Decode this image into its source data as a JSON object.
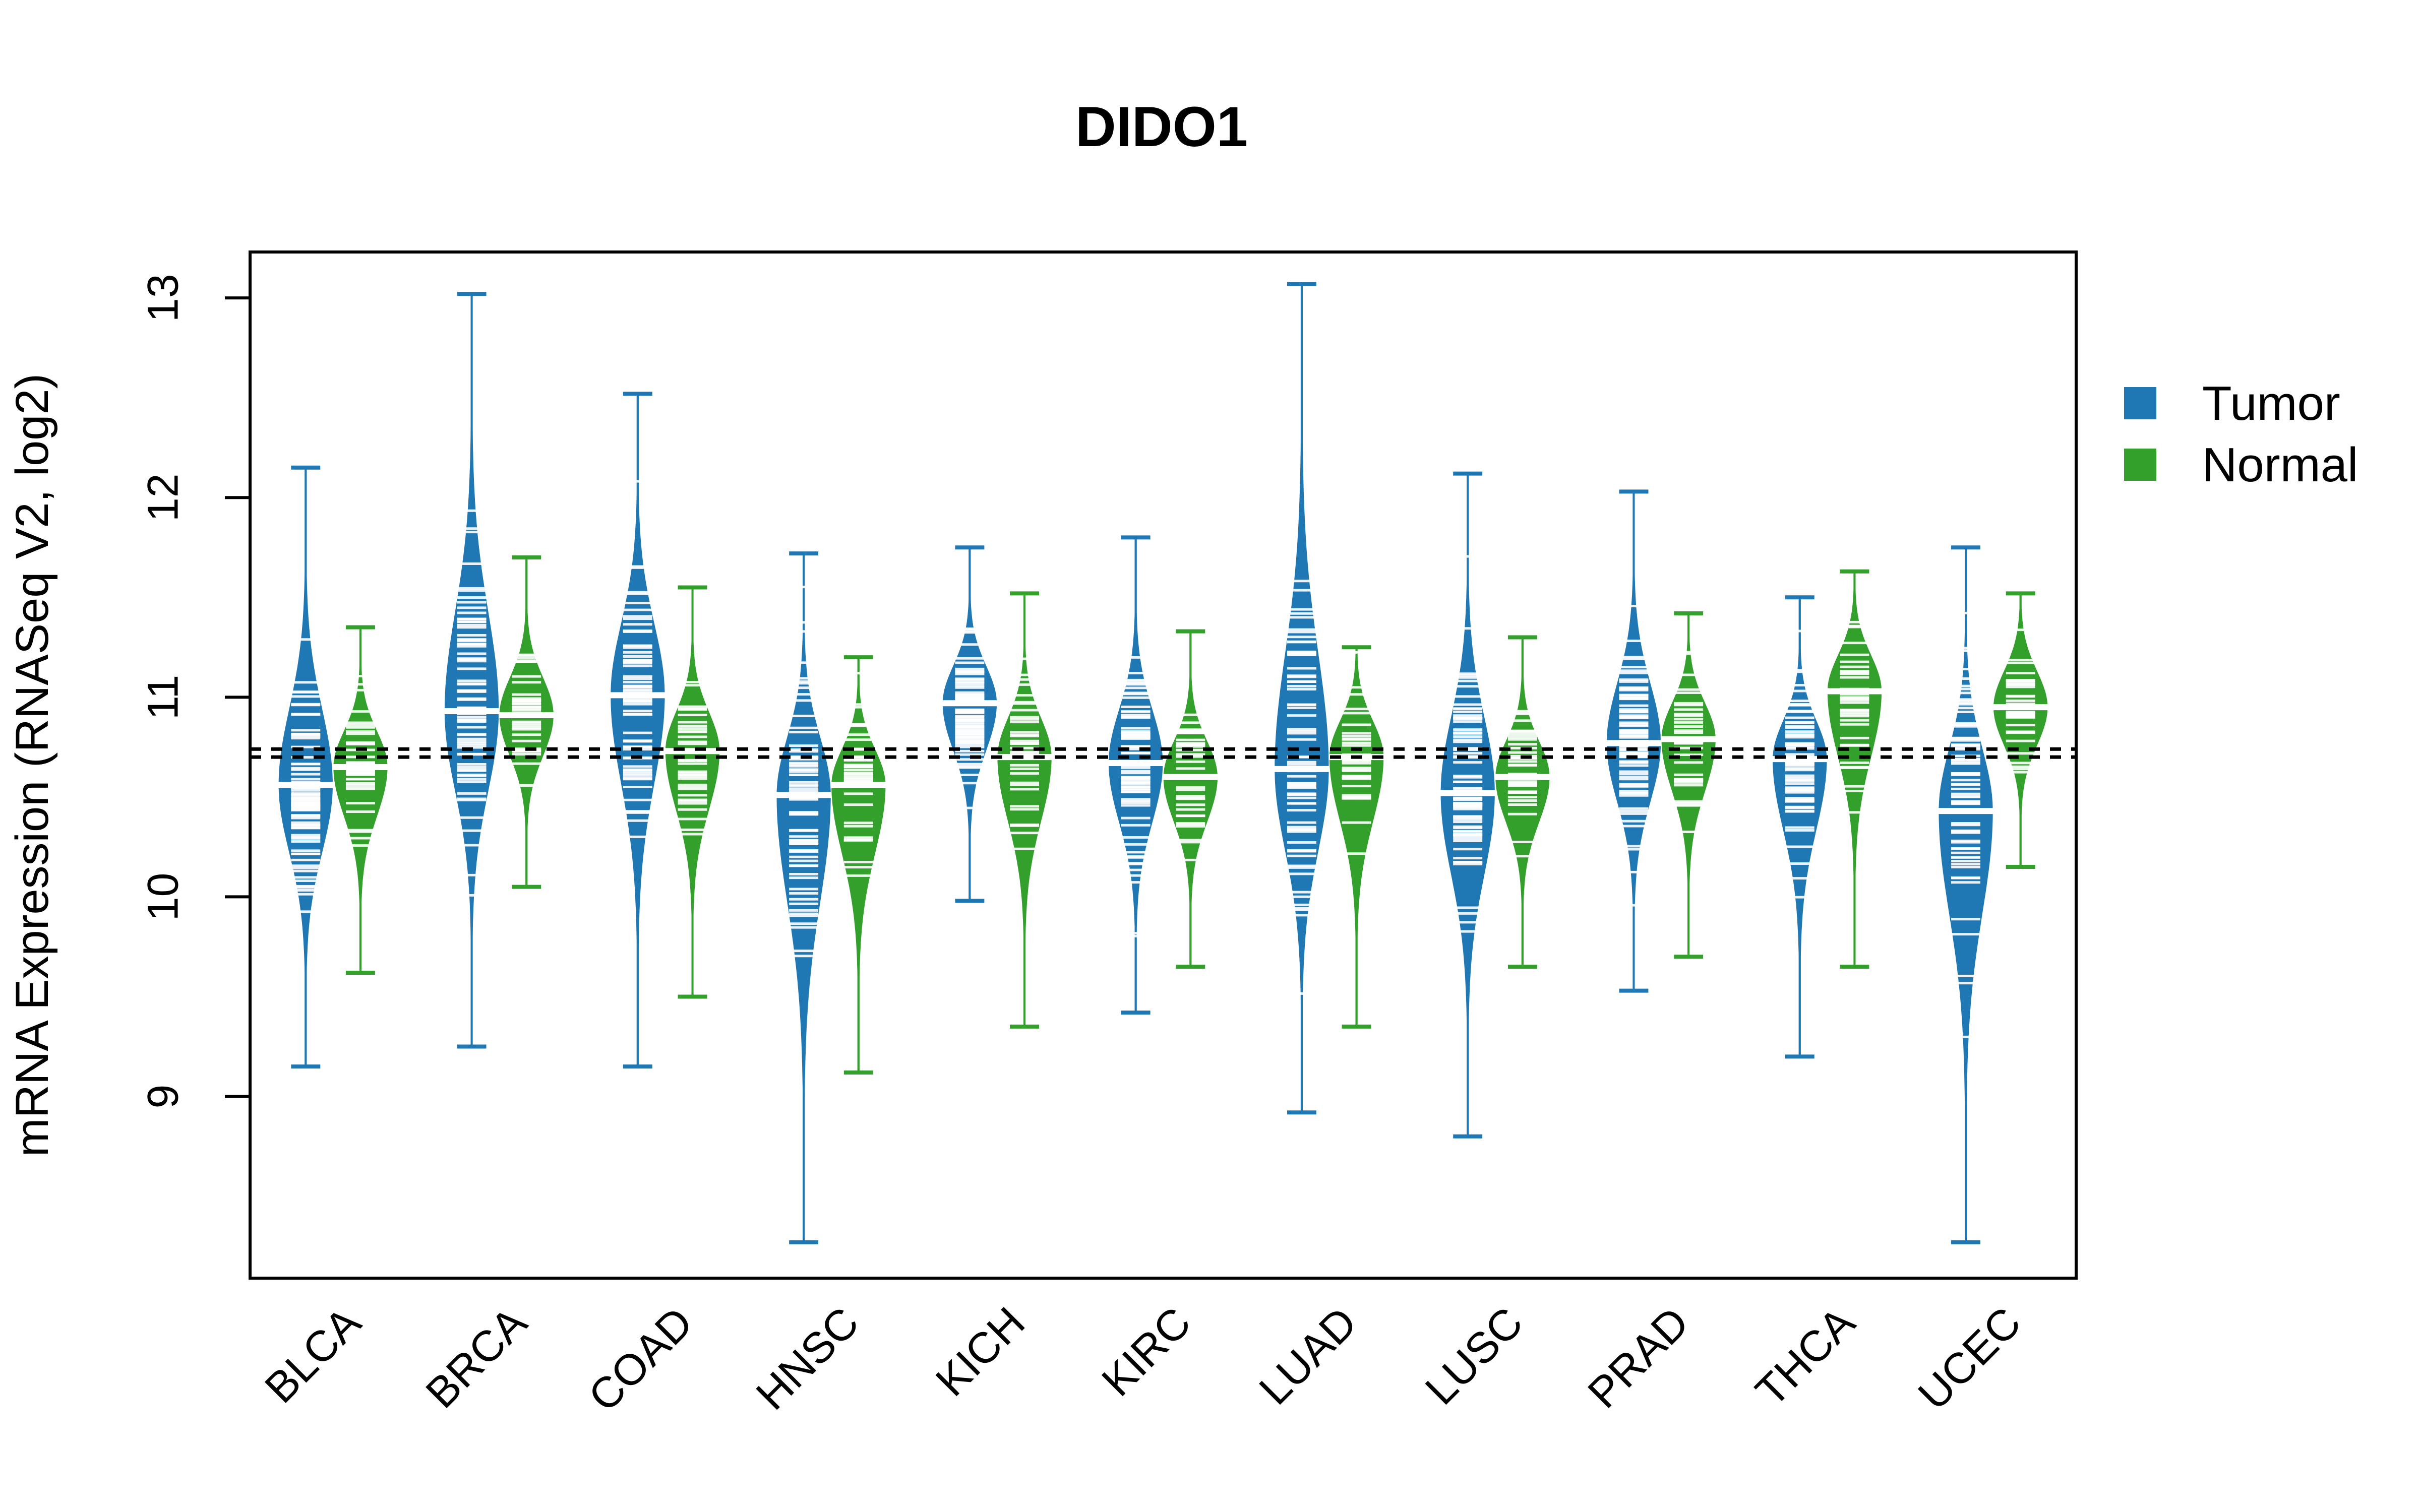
{
  "chart_data": {
    "type": "beanplot",
    "title": "DIDO1",
    "xlabel": "",
    "ylabel": "mRNA Expression (RNASeq V2, log2)",
    "ylim": [
      8.09,
      13.23
    ],
    "yticks": [
      9,
      10,
      11,
      12,
      13
    ],
    "grid": false,
    "legend": {
      "placement": "right",
      "entries": [
        {
          "name": "Tumor",
          "color": "#1F78B4"
        },
        {
          "name": "Normal",
          "color": "#33A02C"
        }
      ]
    },
    "reference_lines": [
      10.74,
      10.7
    ],
    "categories": [
      "BLCA",
      "BRCA",
      "COAD",
      "HNSC",
      "KICH",
      "KIRC",
      "LUAD",
      "LUSC",
      "PRAD",
      "THCA",
      "UCEC"
    ],
    "series": [
      {
        "name": "Tumor",
        "color": "#1F78B4",
        "median": [
          10.56,
          10.93,
          11.01,
          10.51,
          10.97,
          10.67,
          10.64,
          10.52,
          10.77,
          10.69,
          10.43
        ],
        "min": [
          9.15,
          9.25,
          9.15,
          8.27,
          9.98,
          9.42,
          8.92,
          8.8,
          9.53,
          9.2,
          8.27
        ],
        "max": [
          12.15,
          13.02,
          12.52,
          11.72,
          11.75,
          11.8,
          13.07,
          12.12,
          12.03,
          11.5,
          11.75
        ]
      },
      {
        "name": "Normal",
        "color": "#33A02C",
        "median": [
          10.65,
          10.91,
          10.73,
          10.56,
          10.7,
          10.6,
          10.7,
          10.6,
          10.79,
          11.03,
          10.95
        ],
        "min": [
          9.62,
          10.05,
          9.5,
          9.12,
          9.35,
          9.65,
          9.35,
          9.65,
          9.7,
          9.65,
          10.15
        ],
        "max": [
          11.35,
          11.7,
          11.55,
          11.2,
          11.52,
          11.33,
          11.25,
          11.3,
          11.42,
          11.63,
          11.52
        ]
      }
    ]
  }
}
